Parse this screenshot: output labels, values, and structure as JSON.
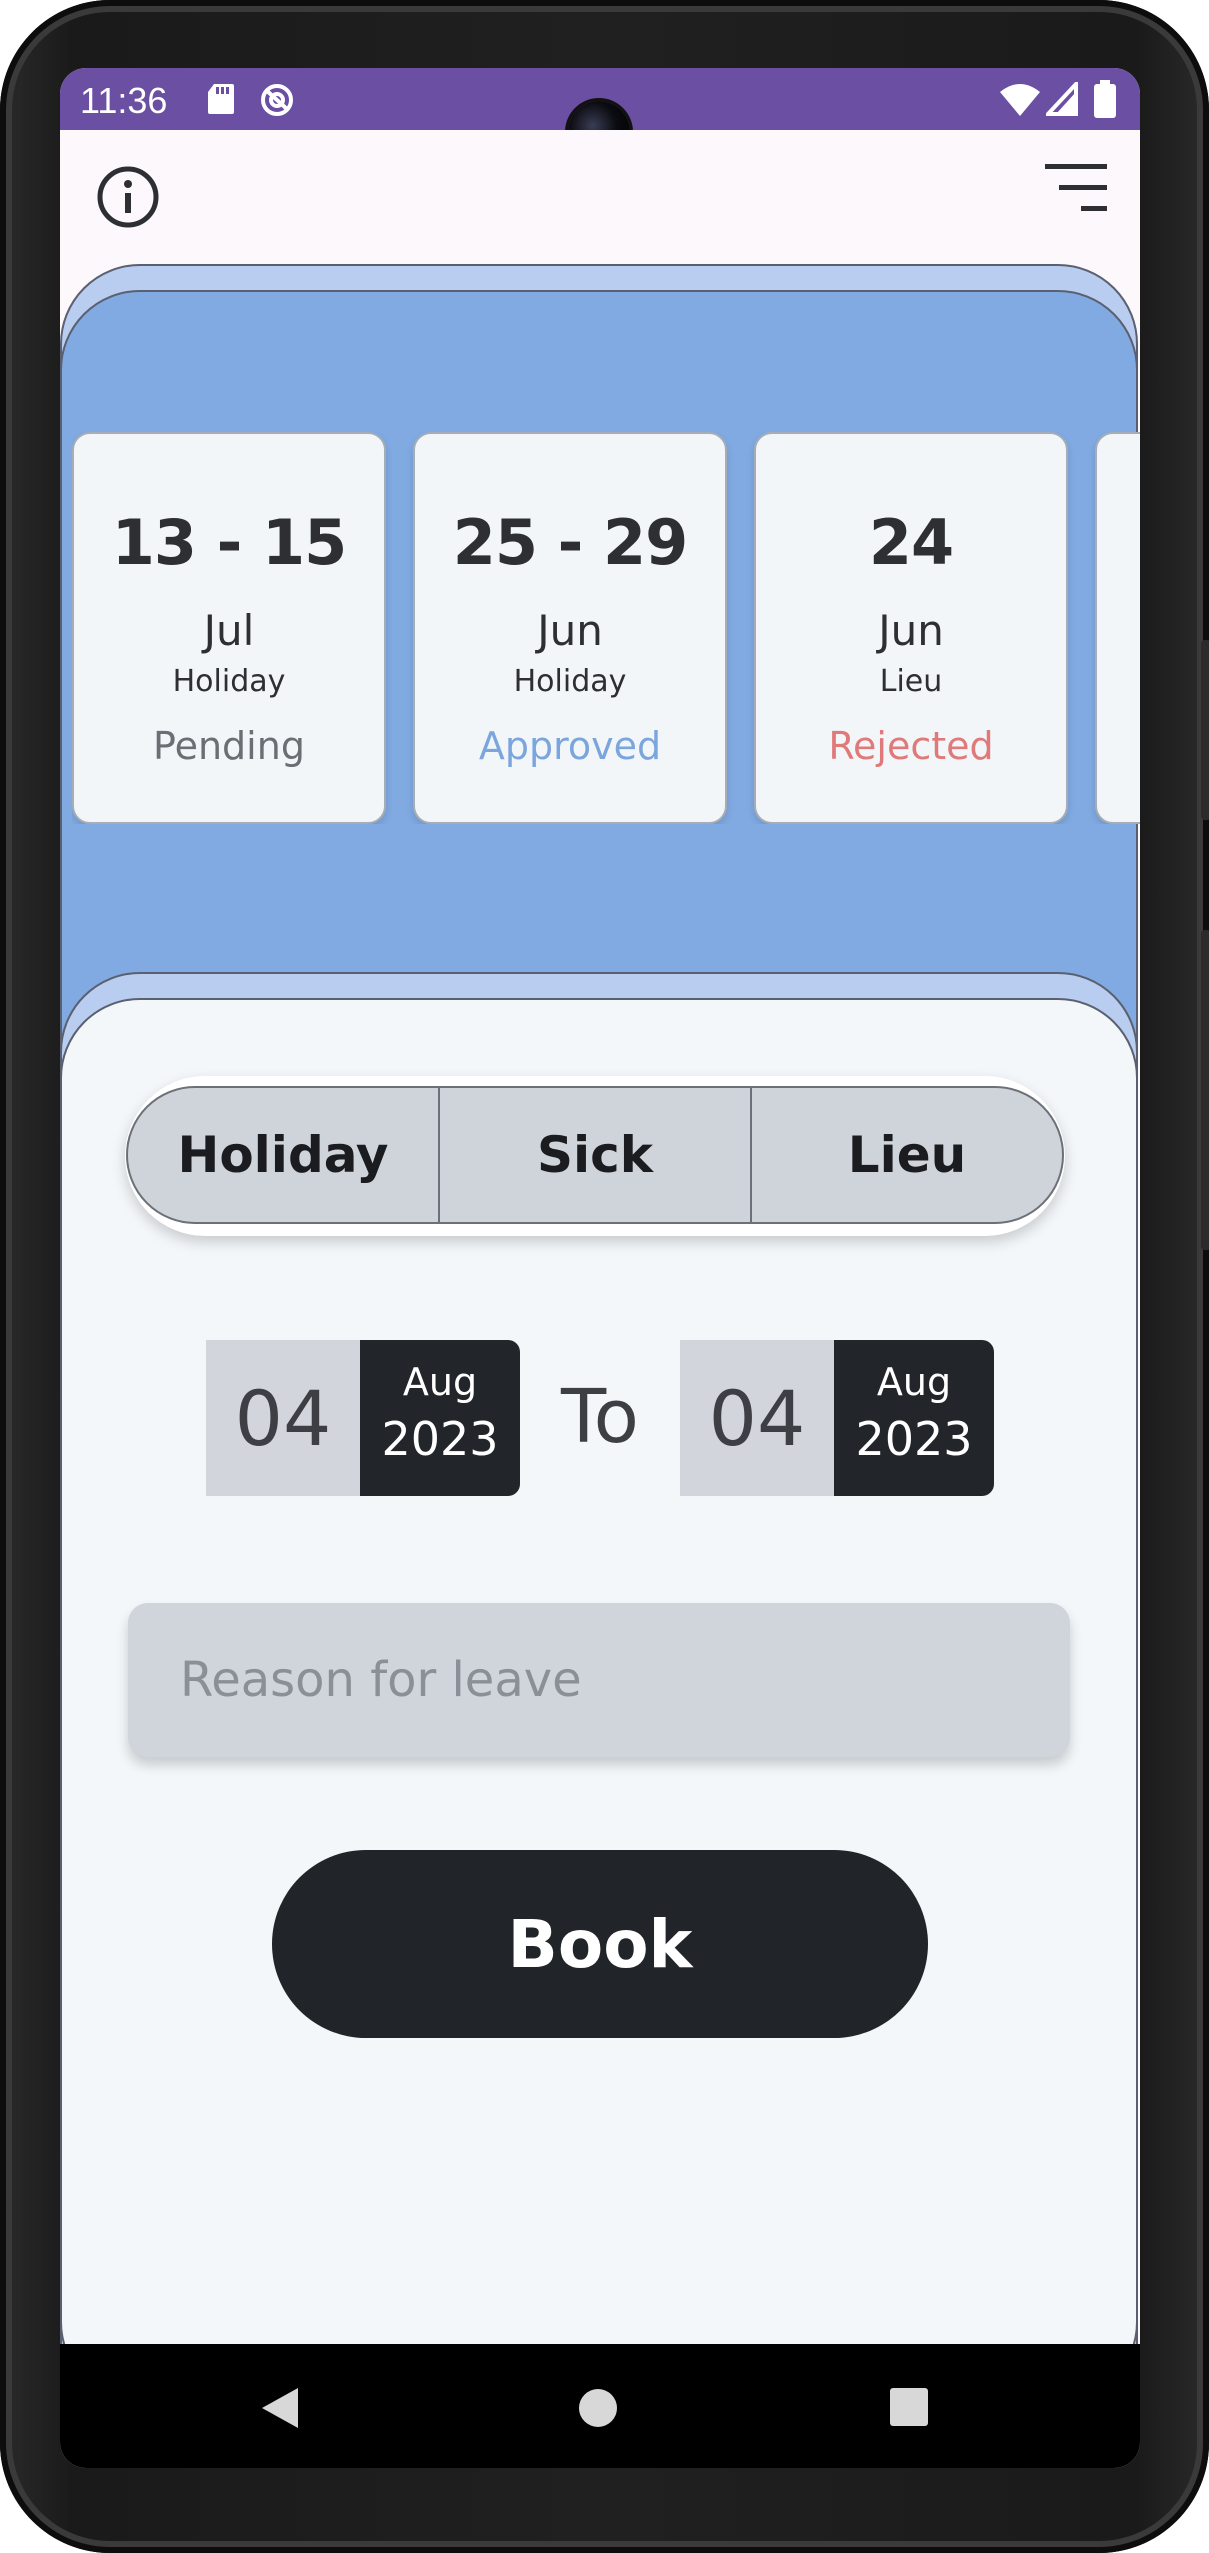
{
  "status_bar": {
    "time": "11:36",
    "left_icons": [
      "sd-card-icon",
      "do-not-disturb-icon"
    ],
    "right_icons": [
      "wifi-icon",
      "cell-signal-icon",
      "battery-icon"
    ]
  },
  "app_bar": {
    "left_icon": "info-icon",
    "right_icon": "menu-icon"
  },
  "leave_requests": [
    {
      "range": "13 - 15",
      "month": "Jul",
      "type": "Holiday",
      "status": "Pending",
      "status_color": "#6b6e74"
    },
    {
      "range": "25 - 29",
      "month": "Jun",
      "type": "Holiday",
      "status": "Approved",
      "status_color": "#7ba6dd"
    },
    {
      "range": "24",
      "month": "Jun",
      "type": "Lieu",
      "status": "Rejected",
      "status_color": "#e07a7a"
    }
  ],
  "leave_type_selector": {
    "options": [
      "Holiday",
      "Sick",
      "Lieu"
    ]
  },
  "date_range": {
    "from": {
      "day": "04",
      "month": "Aug",
      "year": "2023"
    },
    "separator": "To",
    "to": {
      "day": "04",
      "month": "Aug",
      "year": "2023"
    }
  },
  "reason_field": {
    "placeholder": "Reason for leave",
    "value": ""
  },
  "book_button": {
    "label": "Book"
  },
  "navigation_bar": {
    "icons": [
      "back-icon",
      "home-icon",
      "recents-icon"
    ]
  },
  "colors": {
    "status_bar": "#6a4fa3",
    "header_blue": "#80aae1",
    "sheet_background": "#f3f7fa",
    "dark_accent": "#212428"
  }
}
